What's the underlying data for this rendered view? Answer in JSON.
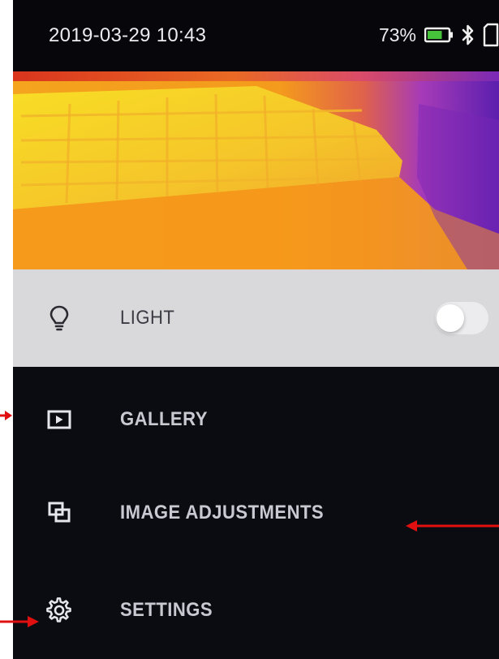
{
  "status_bar": {
    "datetime": "2019-03-29 10:43",
    "battery_percent": "73%",
    "battery_level": 0.73,
    "bluetooth_icon": "bluetooth-icon",
    "sd_card_icon": "sd-card-icon"
  },
  "thermal_view": {
    "palette": "iron",
    "colors": [
      "#f5d21a",
      "#fbb52a",
      "#f39a1e",
      "#d6455a",
      "#8b2ec6",
      "#5a1fb0"
    ]
  },
  "menu": {
    "items": [
      {
        "label": "LIGHT",
        "icon": "lightbulb-icon",
        "toggle": false
      },
      {
        "label": "GALLERY",
        "icon": "gallery-play-icon"
      },
      {
        "label": "IMAGE ADJUSTMENTS",
        "icon": "image-overlay-icon"
      },
      {
        "label": "SETTINGS",
        "icon": "gear-icon"
      }
    ]
  },
  "colors": {
    "screen_background": "#0b0b12",
    "light_row_background": "#d9d9db",
    "annotation_arrow": "#e01010"
  }
}
